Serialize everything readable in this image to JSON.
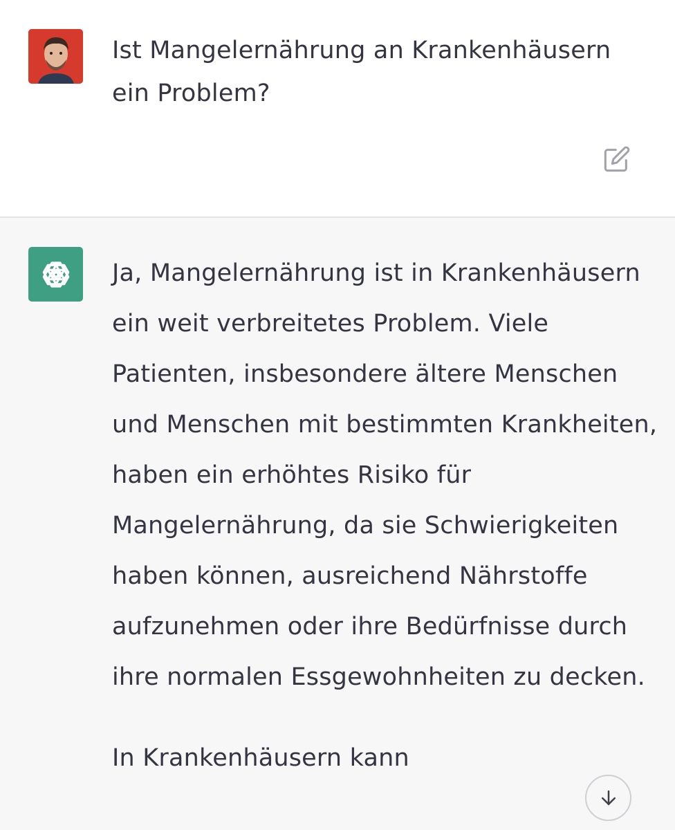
{
  "user_message": {
    "text": "Ist Mangelernährung an Krankenhäusern ein Problem?",
    "avatar_icon": "user-photo-avatar",
    "edit_icon": "edit-icon"
  },
  "assistant_message": {
    "avatar_icon": "openai-logo-icon",
    "paragraphs": [
      "Ja, Mangelernährung ist in Krankenhäusern ein weit verbreitetes Problem. Viele Patienten, insbesondere ältere Menschen und Menschen mit bestimmten Krankheiten, haben ein erhöhtes Risiko für Mangelernährung, da sie Schwierigkeiten haben können, ausreichend Nährstoffe aufzunehmen oder ihre Bedürfnisse durch ihre normalen Essgewohnheiten zu decken.",
      "In Krankenhäusern kann"
    ],
    "scroll_icon": "arrow-down-icon"
  },
  "colors": {
    "assistant_bg": "#f7f7f8",
    "user_bg": "#ffffff",
    "text": "#343541",
    "bot_avatar": "#3f9f83",
    "user_avatar_bg": "#d63a2c"
  }
}
